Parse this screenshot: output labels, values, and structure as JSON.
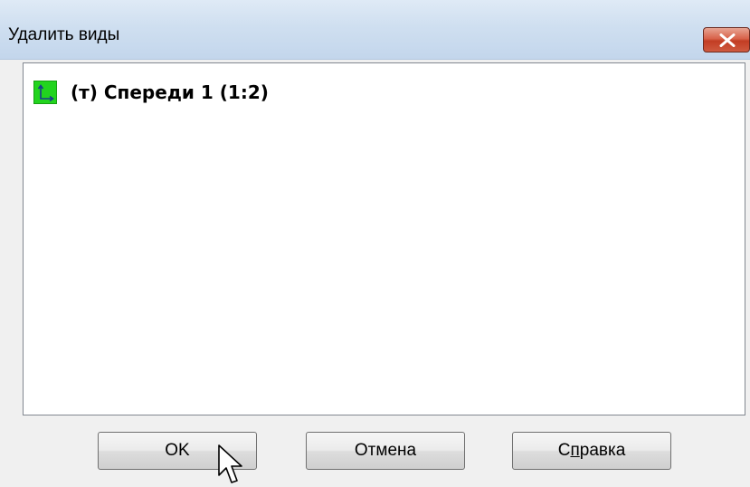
{
  "window": {
    "title": "Удалить виды",
    "close_icon": "close-x-icon"
  },
  "views_list": {
    "items": [
      {
        "label": "(т) Спереди 1 (1:2)",
        "icon": "drawing-view-icon",
        "icon_color": "#22d41e"
      }
    ]
  },
  "buttons": {
    "ok_label": "OK",
    "cancel_label": "Отмена",
    "help_label_pre": "С",
    "help_label_mnemonic": "п",
    "help_label_post": "равка"
  },
  "colors": {
    "titlebar": "#cfdff0",
    "close_button": "#c23d24",
    "dialog_bg": "#f0f0f0",
    "list_bg": "#ffffff"
  },
  "cursor": {
    "icon": "mouse-pointer-icon"
  }
}
